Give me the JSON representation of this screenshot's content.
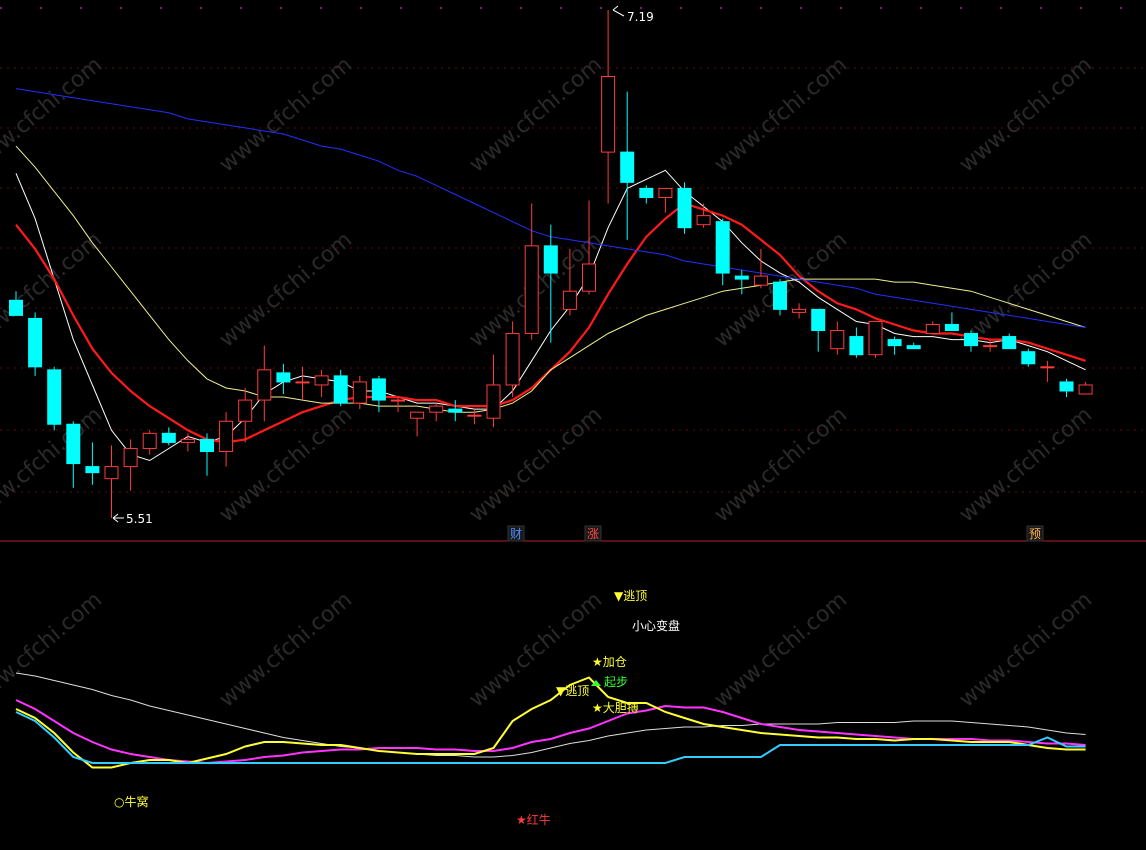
{
  "watermark": "www.cfchi.com",
  "price_panel": {
    "high_marker": "7.19",
    "low_marker": "5.51",
    "event_tags": [
      {
        "text": "财",
        "color": "#4a8cff"
      },
      {
        "text": "涨",
        "color": "#ff4a4a"
      },
      {
        "text": "预",
        "color": "#ffb14a"
      }
    ]
  },
  "signal_panel": {
    "labels": {
      "escape_top_1": "▼逃顶",
      "careful": "小心变盘",
      "add_position": "★加仓",
      "escape_top_2": "▼逃顶",
      "start": "起步",
      "bold_bet": "★大胆搏",
      "cow_nest": "○牛窝",
      "red_cow": "★红牛"
    }
  },
  "colors": {
    "up": "#ff3b3b",
    "down": "#00ffff",
    "ma_white": "#ffffff",
    "ma_red": "#ff1a1a",
    "ma_yellow": "#f0f090",
    "ma_blue": "#2030ff",
    "sig_yellow": "#ffff33",
    "sig_magenta": "#ff33ff",
    "sig_cyan": "#33ccff",
    "sig_white": "#dddddd"
  },
  "chart_data": [
    {
      "type": "candlestick",
      "title": "",
      "price_range": [
        5.45,
        7.25
      ],
      "high_value": 7.19,
      "low_value": 5.51,
      "candles": [
        {
          "o": 6.23,
          "h": 6.26,
          "l": 6.18,
          "c": 6.18
        },
        {
          "o": 6.17,
          "h": 6.19,
          "l": 5.98,
          "c": 6.01
        },
        {
          "o": 6.0,
          "h": 6.01,
          "l": 5.8,
          "c": 5.82
        },
        {
          "o": 5.82,
          "h": 5.83,
          "l": 5.61,
          "c": 5.69
        },
        {
          "o": 5.68,
          "h": 5.76,
          "l": 5.62,
          "c": 5.66
        },
        {
          "o": 5.64,
          "h": 5.75,
          "l": 5.51,
          "c": 5.68
        },
        {
          "o": 5.68,
          "h": 5.77,
          "l": 5.6,
          "c": 5.74
        },
        {
          "o": 5.74,
          "h": 5.8,
          "l": 5.72,
          "c": 5.79
        },
        {
          "o": 5.79,
          "h": 5.81,
          "l": 5.75,
          "c": 5.76
        },
        {
          "o": 5.76,
          "h": 5.79,
          "l": 5.73,
          "c": 5.77
        },
        {
          "o": 5.77,
          "h": 5.79,
          "l": 5.65,
          "c": 5.73
        },
        {
          "o": 5.73,
          "h": 5.86,
          "l": 5.68,
          "c": 5.83
        },
        {
          "o": 5.83,
          "h": 5.94,
          "l": 5.76,
          "c": 5.9
        },
        {
          "o": 5.9,
          "h": 6.08,
          "l": 5.83,
          "c": 6.0
        },
        {
          "o": 5.99,
          "h": 6.02,
          "l": 5.92,
          "c": 5.96
        },
        {
          "o": 5.96,
          "h": 6.01,
          "l": 5.9,
          "c": 5.96
        },
        {
          "o": 5.95,
          "h": 6.0,
          "l": 5.91,
          "c": 5.98
        },
        {
          "o": 5.98,
          "h": 6.0,
          "l": 5.88,
          "c": 5.89
        },
        {
          "o": 5.89,
          "h": 5.98,
          "l": 5.87,
          "c": 5.96
        },
        {
          "o": 5.97,
          "h": 5.98,
          "l": 5.86,
          "c": 5.9
        },
        {
          "o": 5.9,
          "h": 5.91,
          "l": 5.86,
          "c": 5.9
        },
        {
          "o": 5.84,
          "h": 5.86,
          "l": 5.78,
          "c": 5.86
        },
        {
          "o": 5.86,
          "h": 5.89,
          "l": 5.83,
          "c": 5.88
        },
        {
          "o": 5.87,
          "h": 5.9,
          "l": 5.83,
          "c": 5.86
        },
        {
          "o": 5.85,
          "h": 5.87,
          "l": 5.82,
          "c": 5.85
        },
        {
          "o": 5.84,
          "h": 6.05,
          "l": 5.81,
          "c": 5.95
        },
        {
          "o": 5.95,
          "h": 6.16,
          "l": 5.91,
          "c": 6.12
        },
        {
          "o": 6.12,
          "h": 6.55,
          "l": 6.1,
          "c": 6.41
        },
        {
          "o": 6.41,
          "h": 6.48,
          "l": 6.09,
          "c": 6.32
        },
        {
          "o": 6.2,
          "h": 6.4,
          "l": 6.18,
          "c": 6.26
        },
        {
          "o": 6.26,
          "h": 6.56,
          "l": 6.25,
          "c": 6.35
        },
        {
          "o": 6.72,
          "h": 7.19,
          "l": 6.55,
          "c": 6.97
        },
        {
          "o": 6.72,
          "h": 6.92,
          "l": 6.43,
          "c": 6.62
        },
        {
          "o": 6.6,
          "h": 6.61,
          "l": 6.55,
          "c": 6.57
        },
        {
          "o": 6.57,
          "h": 6.6,
          "l": 6.52,
          "c": 6.6
        },
        {
          "o": 6.6,
          "h": 6.62,
          "l": 6.45,
          "c": 6.47
        },
        {
          "o": 6.48,
          "h": 6.55,
          "l": 6.47,
          "c": 6.51
        },
        {
          "o": 6.49,
          "h": 6.5,
          "l": 6.28,
          "c": 6.32
        },
        {
          "o": 6.31,
          "h": 6.33,
          "l": 6.25,
          "c": 6.3
        },
        {
          "o": 6.28,
          "h": 6.4,
          "l": 6.27,
          "c": 6.31
        },
        {
          "o": 6.29,
          "h": 6.3,
          "l": 6.18,
          "c": 6.2
        },
        {
          "o": 6.19,
          "h": 6.22,
          "l": 6.17,
          "c": 6.2
        },
        {
          "o": 6.2,
          "h": 6.2,
          "l": 6.06,
          "c": 6.13
        },
        {
          "o": 6.07,
          "h": 6.16,
          "l": 6.05,
          "c": 6.13
        },
        {
          "o": 6.11,
          "h": 6.14,
          "l": 6.04,
          "c": 6.05
        },
        {
          "o": 6.05,
          "h": 6.16,
          "l": 6.04,
          "c": 6.16
        },
        {
          "o": 6.1,
          "h": 6.11,
          "l": 6.05,
          "c": 6.08
        },
        {
          "o": 6.08,
          "h": 6.09,
          "l": 6.07,
          "c": 6.07
        },
        {
          "o": 6.12,
          "h": 6.16,
          "l": 6.12,
          "c": 6.15
        },
        {
          "o": 6.15,
          "h": 6.19,
          "l": 6.13,
          "c": 6.13
        },
        {
          "o": 6.12,
          "h": 6.13,
          "l": 6.06,
          "c": 6.08
        },
        {
          "o": 6.08,
          "h": 6.1,
          "l": 6.06,
          "c": 6.08
        },
        {
          "o": 6.11,
          "h": 6.12,
          "l": 6.07,
          "c": 6.07
        },
        {
          "o": 6.06,
          "h": 6.07,
          "l": 6.01,
          "c": 6.02
        },
        {
          "o": 6.01,
          "h": 6.03,
          "l": 5.96,
          "c": 6.01
        },
        {
          "o": 5.96,
          "h": 5.97,
          "l": 5.91,
          "c": 5.93
        },
        {
          "o": 5.92,
          "h": 5.96,
          "l": 5.92,
          "c": 5.95
        }
      ],
      "moving_averages": [
        {
          "name": "",
          "color": "#ffffff",
          "values": [
            6.65,
            6.5,
            6.3,
            6.1,
            5.95,
            5.8,
            5.72,
            5.7,
            5.74,
            5.78,
            5.76,
            5.78,
            5.84,
            5.92,
            5.96,
            5.98,
            5.97,
            5.96,
            5.93,
            5.93,
            5.91,
            5.89,
            5.89,
            5.88,
            5.87,
            5.87,
            5.93,
            6.03,
            6.13,
            6.21,
            6.31,
            6.47,
            6.6,
            6.63,
            6.66,
            6.59,
            6.54,
            6.49,
            6.42,
            6.36,
            6.32,
            6.29,
            6.24,
            6.2,
            6.16,
            6.15,
            6.12,
            6.11,
            6.11,
            6.1,
            6.1,
            6.09,
            6.1,
            6.08,
            6.06,
            6.03,
            6.0
          ]
        },
        {
          "name": "",
          "color": "#ff1a1a",
          "values": [
            6.48,
            6.4,
            6.3,
            6.18,
            6.07,
            5.99,
            5.93,
            5.88,
            5.84,
            5.8,
            5.77,
            5.76,
            5.77,
            5.8,
            5.83,
            5.86,
            5.88,
            5.9,
            5.91,
            5.91,
            5.91,
            5.9,
            5.9,
            5.88,
            5.88,
            5.88,
            5.9,
            5.94,
            6.0,
            6.06,
            6.14,
            6.25,
            6.35,
            6.44,
            6.5,
            6.55,
            6.53,
            6.51,
            6.48,
            6.43,
            6.38,
            6.31,
            6.26,
            6.22,
            6.2,
            6.17,
            6.15,
            6.13,
            6.12,
            6.12,
            6.11,
            6.1,
            6.1,
            6.09,
            6.07,
            6.05,
            6.03
          ]
        },
        {
          "name": "",
          "color": "#f0f090",
          "values": [
            6.74,
            6.67,
            6.59,
            6.51,
            6.42,
            6.34,
            6.26,
            6.18,
            6.1,
            6.03,
            5.97,
            5.94,
            5.93,
            5.91,
            5.91,
            5.9,
            5.89,
            5.89,
            5.89,
            5.88,
            5.88,
            5.88,
            5.87,
            5.86,
            5.86,
            5.87,
            5.89,
            5.93,
            6.0,
            6.04,
            6.08,
            6.12,
            6.15,
            6.18,
            6.2,
            6.22,
            6.24,
            6.26,
            6.27,
            6.28,
            6.29,
            6.3,
            6.3,
            6.3,
            6.3,
            6.3,
            6.29,
            6.29,
            6.28,
            6.27,
            6.26,
            6.24,
            6.22,
            6.2,
            6.18,
            6.16,
            6.14
          ]
        },
        {
          "name": "",
          "color": "#2030ff",
          "values": [
            6.93,
            6.92,
            6.91,
            6.9,
            6.89,
            6.88,
            6.87,
            6.86,
            6.85,
            6.83,
            6.82,
            6.81,
            6.8,
            6.79,
            6.78,
            6.76,
            6.74,
            6.73,
            6.71,
            6.69,
            6.66,
            6.64,
            6.61,
            6.58,
            6.55,
            6.52,
            6.49,
            6.46,
            6.44,
            6.43,
            6.42,
            6.41,
            6.4,
            6.39,
            6.38,
            6.36,
            6.35,
            6.34,
            6.33,
            6.32,
            6.31,
            6.3,
            6.29,
            6.28,
            6.27,
            6.25,
            6.24,
            6.23,
            6.22,
            6.21,
            6.2,
            6.19,
            6.18,
            6.17,
            6.16,
            6.15,
            6.14
          ]
        }
      ]
    },
    {
      "type": "line",
      "title": "",
      "ylim": [
        0,
        100
      ],
      "series": [
        {
          "color": "#dddddd",
          "values": [
            78,
            76,
            73,
            70,
            67,
            63,
            60,
            56,
            53,
            50,
            47,
            44,
            41,
            38,
            35,
            33,
            31,
            29,
            28,
            26,
            25,
            24,
            23,
            23,
            22,
            22,
            23,
            25,
            28,
            31,
            33,
            36,
            38,
            40,
            41,
            42,
            42,
            43,
            43,
            44,
            44,
            44,
            44,
            45,
            45,
            45,
            45,
            46,
            46,
            46,
            45,
            44,
            43,
            42,
            40,
            38,
            37
          ]
        },
        {
          "color": "#ff33ff",
          "values": [
            60,
            54,
            46,
            38,
            32,
            27,
            24,
            22,
            20,
            19,
            18,
            19,
            20,
            22,
            23,
            25,
            26,
            27,
            27,
            28,
            28,
            28,
            27,
            27,
            26,
            26,
            28,
            32,
            34,
            38,
            41,
            46,
            51,
            53,
            56,
            55,
            55,
            52,
            48,
            44,
            42,
            40,
            39,
            38,
            37,
            36,
            35,
            34,
            34,
            34,
            34,
            33,
            33,
            32,
            31,
            31,
            30
          ]
        },
        {
          "color": "#ffff33",
          "values": [
            54,
            48,
            38,
            25,
            15,
            15,
            18,
            20,
            20,
            18,
            21,
            24,
            29,
            32,
            32,
            31,
            30,
            30,
            28,
            26,
            25,
            24,
            24,
            24,
            24,
            28,
            46,
            54,
            60,
            70,
            75,
            62,
            58,
            58,
            52,
            48,
            44,
            42,
            40,
            38,
            37,
            36,
            35,
            35,
            34,
            34,
            33,
            34,
            34,
            33,
            32,
            32,
            32,
            30,
            28,
            27,
            27
          ]
        },
        {
          "color": "#33ccff",
          "values": [
            52,
            46,
            35,
            22,
            18,
            18,
            18,
            18,
            18,
            18,
            18,
            18,
            18,
            18,
            18,
            18,
            18,
            18,
            18,
            18,
            18,
            18,
            18,
            18,
            18,
            18,
            18,
            18,
            18,
            18,
            18,
            18,
            18,
            18,
            18,
            22,
            22,
            22,
            22,
            22,
            30,
            30,
            30,
            30,
            30,
            30,
            30,
            30,
            30,
            30,
            30,
            30,
            30,
            30,
            35,
            29,
            29
          ]
        }
      ]
    }
  ]
}
